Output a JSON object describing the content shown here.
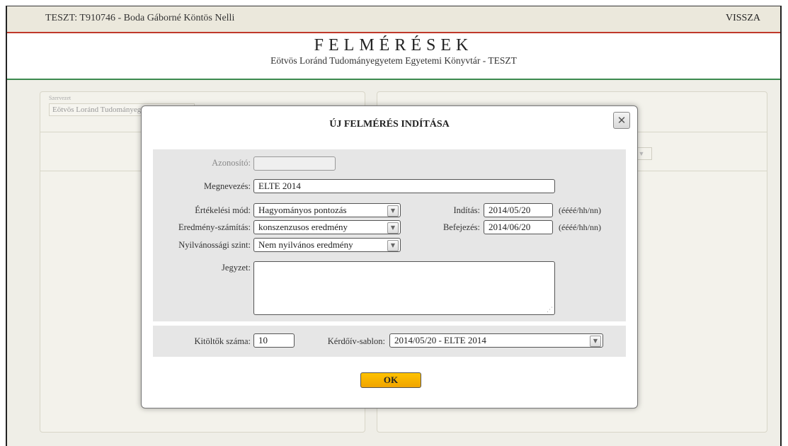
{
  "topbar": {
    "user": "TESZT: T910746 - Boda Gáborné Köntös Nelli",
    "back": "VISSZA"
  },
  "header": {
    "title": "FELMÉRÉSEK",
    "subtitle": "Eötvös Loránd Tudományegyetem Egyetemi Könyvtár - TESZT"
  },
  "background": {
    "org_label": "Szervezet",
    "org_value": "Eötvös Loránd Tudományegyetem"
  },
  "modal": {
    "title": "ÚJ FELMÉRÉS INDÍTÁSA",
    "close_icon": "close-icon",
    "fields": {
      "azonosito_label": "Azonosító:",
      "azonosito_value": "",
      "megnevezes_label": "Megnevezés:",
      "megnevezes_value": "ELTE 2014",
      "ertekelesi_label": "Értékelési mód:",
      "ertekelesi_value": "Hagyományos pontozás",
      "eredmeny_label": "Eredmény-számítás:",
      "eredmeny_value": "konszenzusos eredmény",
      "nyilvanossag_label": "Nyilvánossági szint:",
      "nyilvanossag_value": "Nem nyilvános eredmény",
      "jegyzet_label": "Jegyzet:",
      "jegyzet_value": "",
      "inditas_label": "Indítás:",
      "inditas_value": "2014/05/20",
      "befejezes_label": "Befejezés:",
      "befejezes_value": "2014/06/20",
      "date_hint": "(éééé/hh/nn)"
    },
    "bottom": {
      "kitoltok_label": "Kitöltők száma:",
      "kitoltok_value": "10",
      "sablon_label": "Kérdőív-sablon:",
      "sablon_value": "2014/05/20 - ELTE 2014"
    },
    "ok_label": "OK",
    "ok_color": "#f5ad00"
  }
}
